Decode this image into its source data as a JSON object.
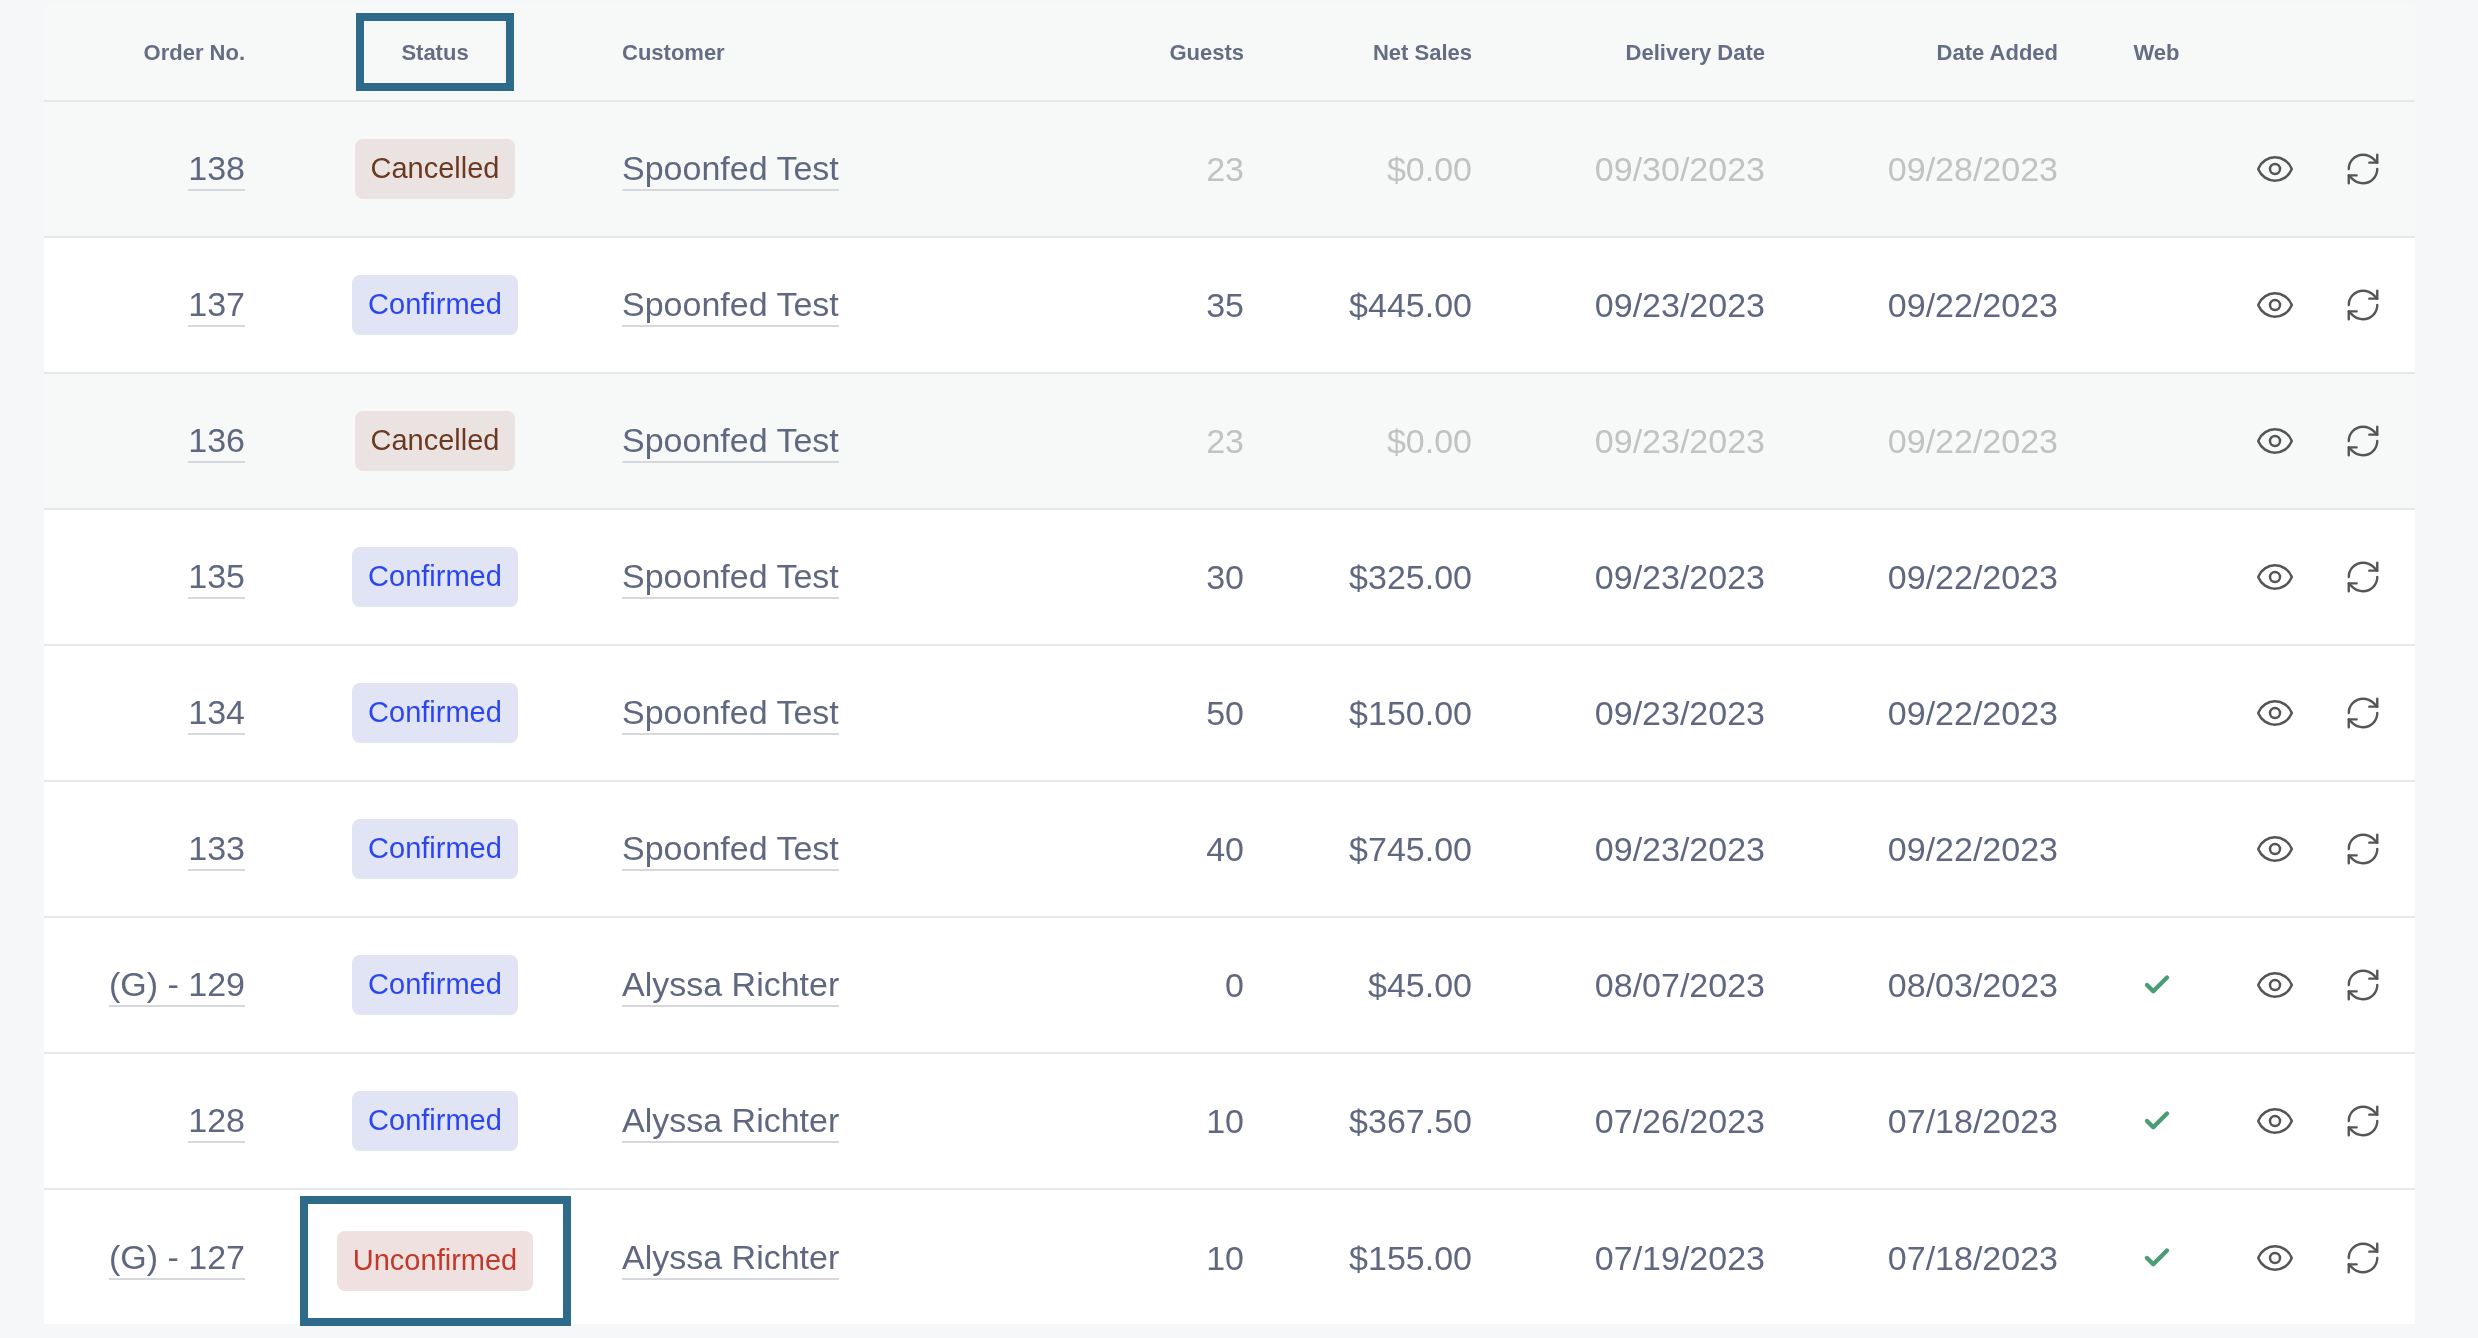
{
  "table": {
    "columns": [
      {
        "label": "Order No.",
        "highlighted": false
      },
      {
        "label": "Status",
        "highlighted": true
      },
      {
        "label": "Customer",
        "highlighted": false
      },
      {
        "label": "Guests",
        "highlighted": false
      },
      {
        "label": "Net Sales",
        "highlighted": false
      },
      {
        "label": "Delivery Date",
        "highlighted": false
      },
      {
        "label": "Date Added",
        "highlighted": false
      },
      {
        "label": "Web",
        "highlighted": false
      }
    ],
    "rows": [
      {
        "order": "138",
        "status": {
          "label": "Cancelled",
          "kind": "cancelled",
          "highlighted": false
        },
        "customer": "Spoonfed Test",
        "guests": "23",
        "net_sales": "$0.00",
        "delivery_date": "09/30/2023",
        "date_added": "09/28/2023",
        "web": false
      },
      {
        "order": "137",
        "status": {
          "label": "Confirmed",
          "kind": "confirmed",
          "highlighted": false
        },
        "customer": "Spoonfed Test",
        "guests": "35",
        "net_sales": "$445.00",
        "delivery_date": "09/23/2023",
        "date_added": "09/22/2023",
        "web": false
      },
      {
        "order": "136",
        "status": {
          "label": "Cancelled",
          "kind": "cancelled",
          "highlighted": false
        },
        "customer": "Spoonfed Test",
        "guests": "23",
        "net_sales": "$0.00",
        "delivery_date": "09/23/2023",
        "date_added": "09/22/2023",
        "web": false
      },
      {
        "order": "135",
        "status": {
          "label": "Confirmed",
          "kind": "confirmed",
          "highlighted": false
        },
        "customer": "Spoonfed Test",
        "guests": "30",
        "net_sales": "$325.00",
        "delivery_date": "09/23/2023",
        "date_added": "09/22/2023",
        "web": false
      },
      {
        "order": "134",
        "status": {
          "label": "Confirmed",
          "kind": "confirmed",
          "highlighted": false
        },
        "customer": "Spoonfed Test",
        "guests": "50",
        "net_sales": "$150.00",
        "delivery_date": "09/23/2023",
        "date_added": "09/22/2023",
        "web": false
      },
      {
        "order": "133",
        "status": {
          "label": "Confirmed",
          "kind": "confirmed",
          "highlighted": false
        },
        "customer": "Spoonfed Test",
        "guests": "40",
        "net_sales": "$745.00",
        "delivery_date": "09/23/2023",
        "date_added": "09/22/2023",
        "web": false
      },
      {
        "order": "(G) - 129",
        "status": {
          "label": "Confirmed",
          "kind": "confirmed",
          "highlighted": false
        },
        "customer": "Alyssa Richter",
        "guests": "0",
        "net_sales": "$45.00",
        "delivery_date": "08/07/2023",
        "date_added": "08/03/2023",
        "web": true
      },
      {
        "order": "128",
        "status": {
          "label": "Confirmed",
          "kind": "confirmed",
          "highlighted": false
        },
        "customer": "Alyssa Richter",
        "guests": "10",
        "net_sales": "$367.50",
        "delivery_date": "07/26/2023",
        "date_added": "07/18/2023",
        "web": true
      },
      {
        "order": "(G) - 127",
        "status": {
          "label": "Unconfirmed",
          "kind": "unconfirmed",
          "highlighted": true
        },
        "customer": "Alyssa Richter",
        "guests": "10",
        "net_sales": "$155.00",
        "delivery_date": "07/19/2023",
        "date_added": "07/18/2023",
        "web": true
      }
    ]
  }
}
